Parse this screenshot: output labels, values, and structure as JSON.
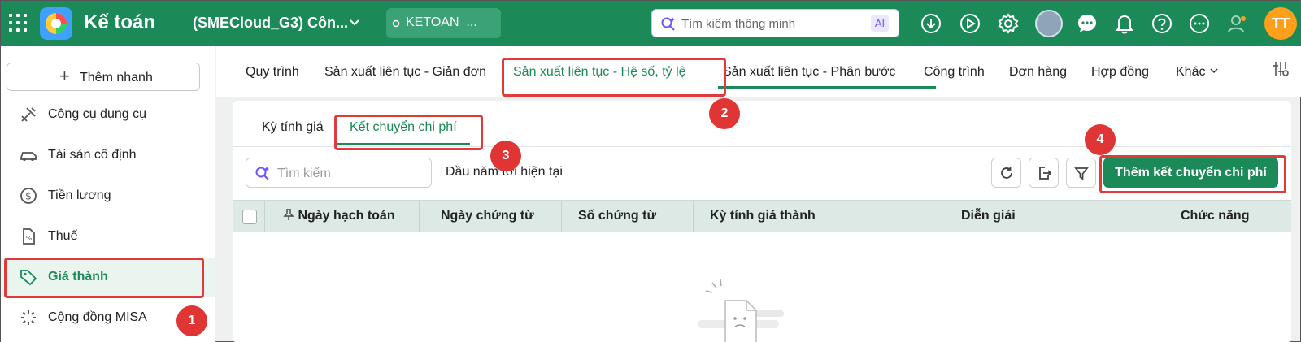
{
  "topbar": {
    "app_title": "Kế toán",
    "company": "(SMECloud_G3) Côn...",
    "database": "KETOAN_...",
    "search_placeholder": "Tìm kiếm thông minh",
    "ai_label": "AI",
    "user_initials": "TT",
    "icons": [
      "apps-grid-icon",
      "download-icon",
      "play-icon",
      "settings-icon",
      "avatar",
      "chat-icon",
      "bell-icon",
      "help-icon",
      "more-icon",
      "user-icon"
    ]
  },
  "sidebar": {
    "quick_add": "Thêm nhanh",
    "items": [
      {
        "label": "Công cụ dụng cụ",
        "icon": "tools-icon"
      },
      {
        "label": "Tài sản cố định",
        "icon": "car-icon"
      },
      {
        "label": "Tiền lương",
        "icon": "dollar-icon"
      },
      {
        "label": "Thuế",
        "icon": "tax-doc-icon"
      },
      {
        "label": "Giá thành",
        "icon": "price-tag-icon",
        "active": true
      },
      {
        "label": "Cộng đồng MISA",
        "icon": "community-icon"
      }
    ]
  },
  "tabs": [
    {
      "label": "Quy trình"
    },
    {
      "label": "Sản xuất liên tục - Giản đơn"
    },
    {
      "label": "Sản xuất liên tục - Hệ số, tỷ lệ",
      "active": true
    },
    {
      "label": "Sản xuất liên tục - Phân bước"
    },
    {
      "label": "Công trình"
    },
    {
      "label": "Đơn hàng"
    },
    {
      "label": "Hợp đồng"
    },
    {
      "label": "Khác"
    }
  ],
  "subtabs": [
    {
      "label": "Kỳ tính giá"
    },
    {
      "label": "Kết chuyển chi phí",
      "active": true
    }
  ],
  "toolbar": {
    "search_placeholder": "Tìm kiếm",
    "period": "Đầu năm tới hiện tại",
    "add_button": "Thêm kết chuyển chi phí"
  },
  "table": {
    "columns": [
      "Ngày hạch toán",
      "Ngày chứng từ",
      "Số chứng từ",
      "Kỳ tính giá thành",
      "Diễn giải",
      "Chức năng"
    ]
  },
  "annotations": [
    "1",
    "2",
    "3",
    "4"
  ],
  "colors": {
    "brand": "#1b8a58",
    "highlight": "#e03b3b"
  }
}
